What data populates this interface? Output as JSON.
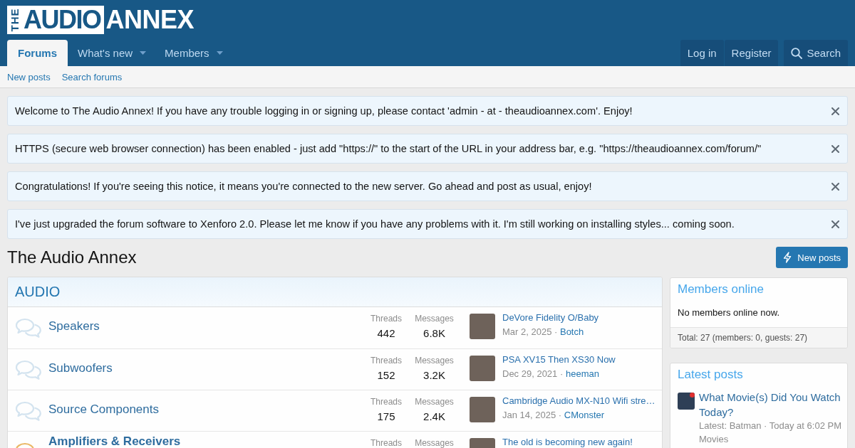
{
  "logo": [
    {
      "text": "THE",
      "kind": "vertical"
    },
    {
      "text": "AUDIO",
      "kind": "boxed"
    },
    {
      "text": "ANNEX",
      "kind": "plain"
    }
  ],
  "nav": {
    "tabs": [
      {
        "label": "Forums",
        "selected": true,
        "dropdown": false
      },
      {
        "label": "What's new",
        "selected": false,
        "dropdown": true
      },
      {
        "label": "Members",
        "selected": false,
        "dropdown": true
      }
    ],
    "account_buttons": [
      "Log in",
      "Register"
    ],
    "search_button": "Search"
  },
  "subnav": [
    "New posts",
    "Search forums"
  ],
  "notices": [
    {
      "text": "Welcome to The Audio Annex! If you have any trouble logging in or signing up, please contact 'admin - at - theaudioannex.com'. Enjoy!"
    },
    {
      "text": "HTTPS (secure web browser connection) has been enabled - just add \"https://\" to the start of the URL in your address bar, e.g. \"https://theaudioannex.com/forum/\""
    },
    {
      "text": "Congratulations! If you're seeing this notice, it means you're connected to the new server. Go ahead and post as usual, enjoy!"
    },
    {
      "text": "I've just upgraded the forum software to Xenforo 2.0. Please let me know if you have any problems with it. I'm still working on installing styles... coming soon."
    }
  ],
  "page_title": "The Audio Annex",
  "new_posts_button": "New posts",
  "category": {
    "title": "AUDIO",
    "forums": [
      {
        "title": "Speakers",
        "unread": false,
        "stats": [
          {
            "label": "Threads",
            "value": "442"
          },
          {
            "label": "Messages",
            "value": "6.8K"
          }
        ],
        "last_post": {
          "title": "DeVore Fidelity O/Baby",
          "date": "Mar 2, 2025",
          "separator": "·",
          "user": "Botch"
        }
      },
      {
        "title": "Subwoofers",
        "unread": false,
        "stats": [
          {
            "label": "Threads",
            "value": "152"
          },
          {
            "label": "Messages",
            "value": "3.2K"
          }
        ],
        "last_post": {
          "title": "PSA XV15 Then XS30 Now",
          "date": "Dec 29, 2021",
          "separator": "·",
          "user": "heeman"
        }
      },
      {
        "title": "Source Components",
        "unread": false,
        "stats": [
          {
            "label": "Threads",
            "value": "175"
          },
          {
            "label": "Messages",
            "value": "2.4K"
          }
        ],
        "last_post": {
          "title": "Cambridge Audio MX-N10 Wifi stre…",
          "date": "Jan 14, 2025",
          "separator": "·",
          "user": "CMonster"
        }
      },
      {
        "title": "Amplifiers & Receivers",
        "unread": true,
        "stats": [
          {
            "label": "Threads"
          },
          {
            "label": "Messages"
          }
        ],
        "last_post": {
          "title": "The old is becoming new again!"
        }
      }
    ]
  },
  "sidebar": {
    "members_online": {
      "title": "Members online",
      "text": "No members online now.",
      "total": "Total: 27 (members: 0, guests: 27)"
    },
    "latest_posts": {
      "title": "Latest posts",
      "items": [
        {
          "title": "What Movie(s) Did You Watch Today?",
          "unread": true,
          "latest": "Latest: Batman",
          "separator": "·",
          "time": "Today at 6:02 PM",
          "forum": "Movies"
        }
      ]
    }
  }
}
